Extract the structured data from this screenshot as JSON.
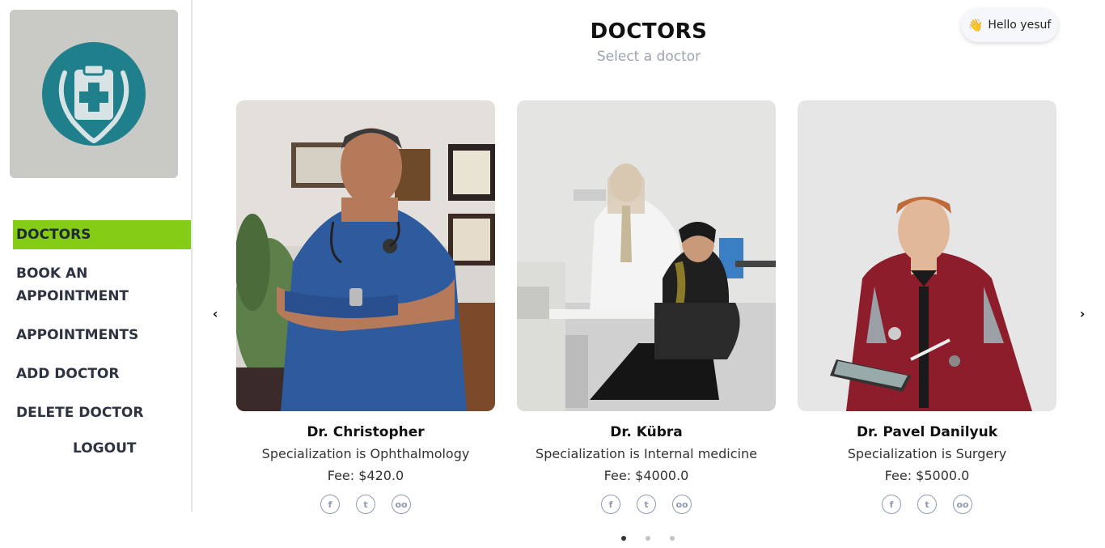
{
  "sidebar": {
    "nav": {
      "doctors": "DOCTORS",
      "book_line1": "BOOK AN",
      "book_line2": "APPOINTMENT",
      "appointments": "APPOINTMENTS",
      "add_doctor": "ADD DOCTOR",
      "delete_doctor": "DELETE DOCTOR",
      "logout": "LOGOUT"
    }
  },
  "header": {
    "title": "DOCTORS",
    "subtitle": "Select a doctor",
    "greeting": "Hello yesuf",
    "greeting_icon": "waving-hand-icon"
  },
  "doctors": [
    {
      "name": "Dr. Christopher",
      "specialization": "Specialization is Ophthalmology",
      "fee": "Fee: $420.0"
    },
    {
      "name": "Dr. Kübra",
      "specialization": "Specialization is Internal medicine",
      "fee": "Fee: $4000.0"
    },
    {
      "name": "Dr. Pavel Danilyuk",
      "specialization": "Specialization is Surgery",
      "fee": "Fee: $5000.0"
    }
  ],
  "social_icons": [
    "facebook-icon",
    "twitter-icon",
    "tripadvisor-icon"
  ],
  "carousel": {
    "active_page": 1,
    "page_count": 3
  },
  "colors": {
    "accent": "#84cc16",
    "logo_teal": "#1f7f8a",
    "logo_bg": "#c9c9c6"
  }
}
